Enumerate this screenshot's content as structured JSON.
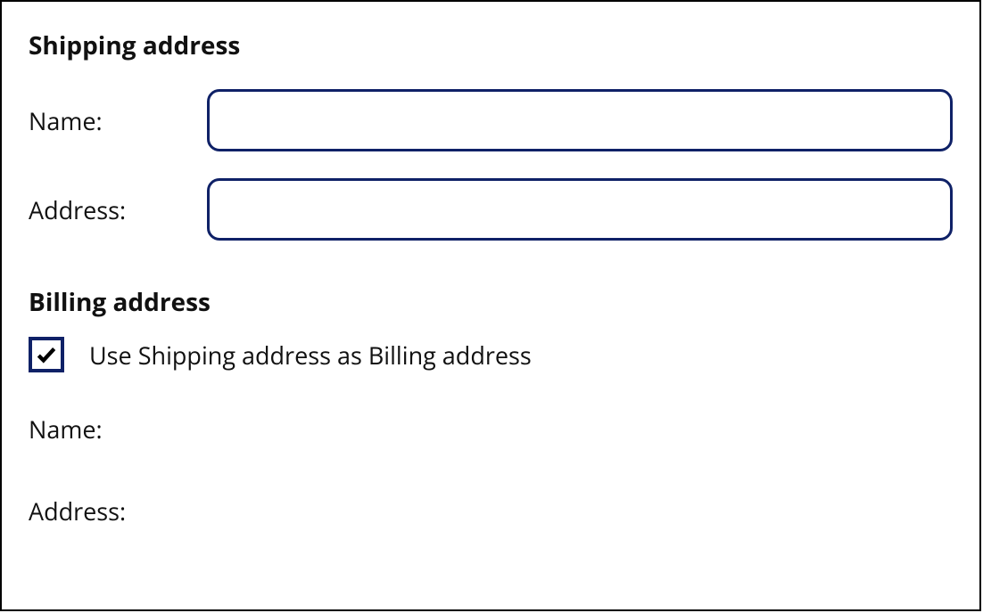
{
  "shipping": {
    "heading": "Shipping address",
    "name_label": "Name:",
    "name_value": "",
    "address_label": "Address:",
    "address_value": ""
  },
  "billing": {
    "heading": "Billing address",
    "use_shipping_checked": true,
    "use_shipping_label": "Use Shipping address as Billing address",
    "name_label": "Name:",
    "address_label": "Address:"
  }
}
